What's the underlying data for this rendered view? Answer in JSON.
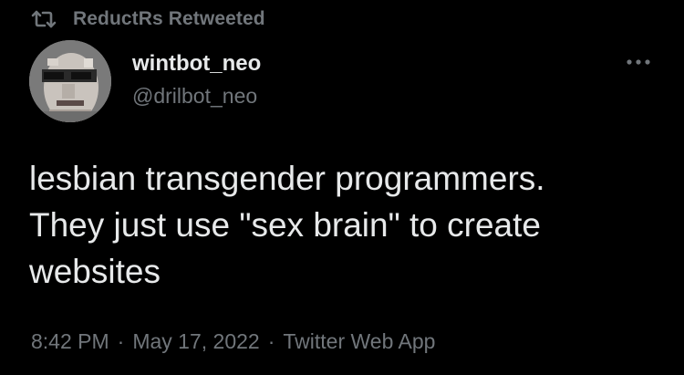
{
  "retweet_banner": {
    "text": "ReductRs Retweeted",
    "icon": "retweet-icon"
  },
  "author": {
    "display_name": "wintbot_neo",
    "handle": "@drilbot_neo",
    "avatar_icon": "avatar"
  },
  "more_icon": "more-dots-icon",
  "tweet": {
    "text": "lesbian transgender programmers.\nThey just use \"sex brain\" to create\nwebsites"
  },
  "meta": {
    "time": "8:42 PM",
    "separator": "·",
    "date": "May 17, 2022",
    "source": "Twitter Web App"
  },
  "colors": {
    "background": "#000000",
    "primary_text": "#e7e9ea",
    "secondary_text": "#71767b"
  }
}
